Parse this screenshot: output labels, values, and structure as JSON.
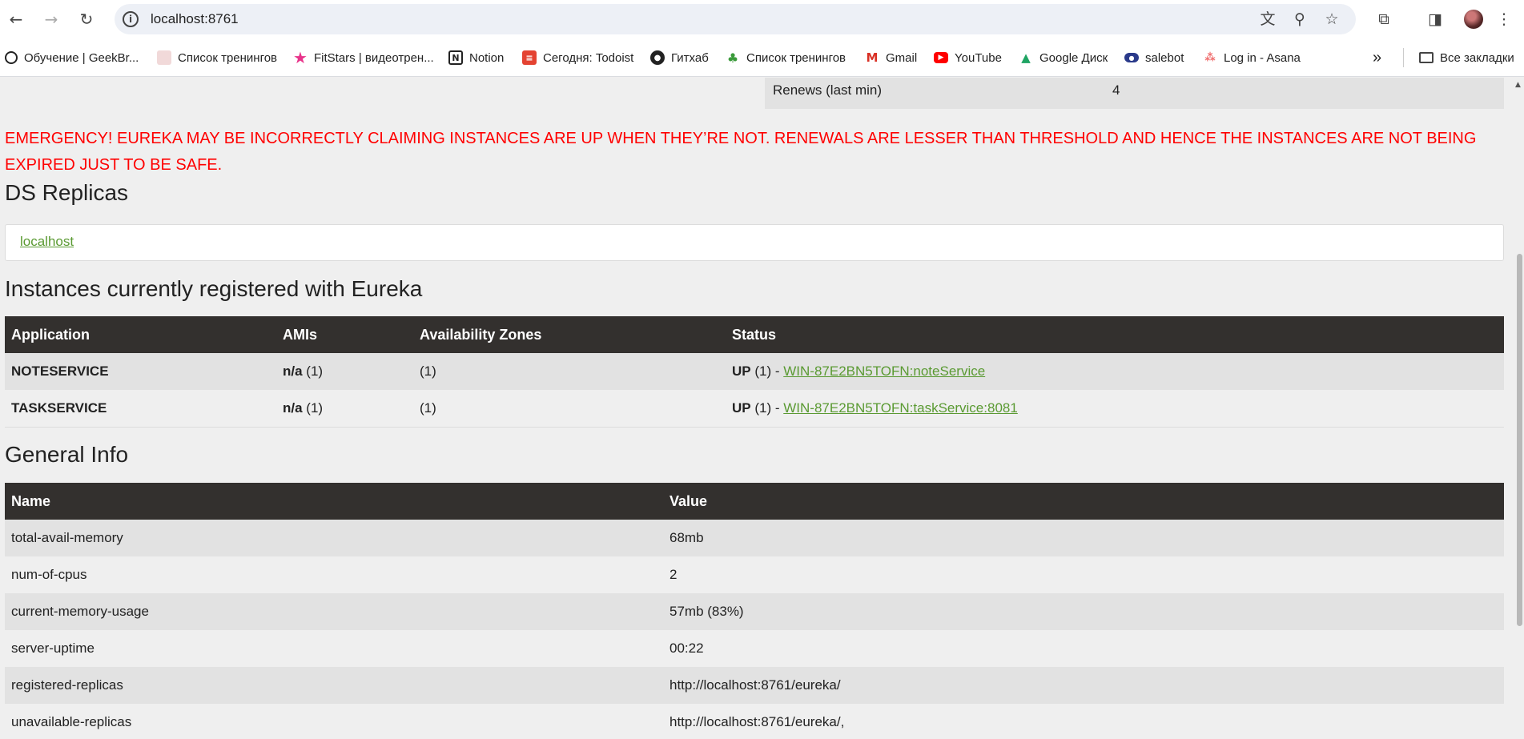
{
  "browser": {
    "url": "localhost:8761",
    "bookmarks": [
      {
        "label": "Обучение | GeekBr...",
        "icon": "geekbrains-icon"
      },
      {
        "label": "Список тренингов",
        "icon": "page-icon"
      },
      {
        "label": "FitStars | видеотрен...",
        "icon": "star-icon"
      },
      {
        "label": "Notion",
        "icon": "notion-icon"
      },
      {
        "label": "Сегодня: Todoist",
        "icon": "todoist-icon"
      },
      {
        "label": "Гитхаб",
        "icon": "github-icon"
      },
      {
        "label": "Список тренингов",
        "icon": "sprout-icon"
      },
      {
        "label": "Gmail",
        "icon": "gmail-icon"
      },
      {
        "label": "YouTube",
        "icon": "youtube-icon"
      },
      {
        "label": "Google Диск",
        "icon": "google-drive-icon"
      },
      {
        "label": "salebot",
        "icon": "salebot-icon"
      },
      {
        "label": "Log in - Asana",
        "icon": "asana-icon"
      }
    ],
    "all_bookmarks_label": "Все закладки"
  },
  "renews": {
    "label": "Renews (last min)",
    "value": "4"
  },
  "emergency": "EMERGENCY! EUREKA MAY BE INCORRECTLY CLAIMING INSTANCES ARE UP WHEN THEY’RE NOT. RENEWALS ARE LESSER THAN THRESHOLD AND HENCE THE INSTANCES ARE NOT BEING EXPIRED JUST TO BE SAFE.",
  "ds_replicas": {
    "title": "DS Replicas",
    "link": "localhost"
  },
  "instances": {
    "title": "Instances currently registered with Eureka",
    "headers": [
      "Application",
      "AMIs",
      "Availability Zones",
      "Status"
    ],
    "rows": [
      {
        "app": "NOTESERVICE",
        "amis_bold": "n/a",
        "amis_count": " (1)",
        "zones": "(1)",
        "status_up": "UP",
        "status_rest": " (1) - ",
        "instance": "WIN-87E2BN5TOFN:noteService"
      },
      {
        "app": "TASKSERVICE",
        "amis_bold": "n/a",
        "amis_count": " (1)",
        "zones": "(1)",
        "status_up": "UP",
        "status_rest": " (1) - ",
        "instance": "WIN-87E2BN5TOFN:taskService:8081"
      }
    ]
  },
  "general_info": {
    "title": "General Info",
    "headers": [
      "Name",
      "Value"
    ],
    "rows": [
      {
        "name": "total-avail-memory",
        "value": "68mb"
      },
      {
        "name": "num-of-cpus",
        "value": "2"
      },
      {
        "name": "current-memory-usage",
        "value": "57mb (83%)"
      },
      {
        "name": "server-uptime",
        "value": "00:22"
      },
      {
        "name": "registered-replicas",
        "value": "http://localhost:8761/eureka/"
      },
      {
        "name": "unavailable-replicas",
        "value": "http://localhost:8761/eureka/,"
      }
    ]
  },
  "colors": {
    "emergency": "#ff0000",
    "link": "#5a9a32",
    "table_header": "#33302e"
  }
}
